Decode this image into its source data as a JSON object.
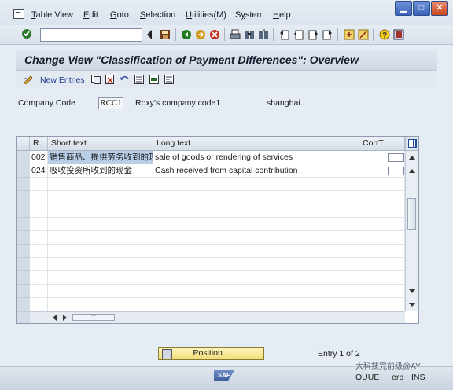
{
  "menu": {
    "items": [
      {
        "label": "Table View",
        "u": "T"
      },
      {
        "label": "Edit",
        "u": "E"
      },
      {
        "label": "Goto",
        "u": "G"
      },
      {
        "label": "Selection",
        "u": "S"
      },
      {
        "label": "Utilities(M)",
        "u": "U"
      },
      {
        "label": "System",
        "u": "y"
      },
      {
        "label": "Help",
        "u": "H"
      }
    ]
  },
  "toolbar": {
    "command_field_value": "",
    "icons": [
      "enter-icon",
      "back-icon",
      "exit-icon",
      "cancel-icon",
      "print-icon",
      "find-icon",
      "find-next-icon",
      "first-page-icon",
      "previous-page-icon",
      "next-page-icon",
      "last-page-icon",
      "create-session-icon",
      "shortcut-icon",
      "help-icon",
      "customize-icon"
    ]
  },
  "screen": {
    "title": "Change View \"Classification of Payment Differences\": Overview"
  },
  "app_toolbar": {
    "new_entries_label": "New Entries"
  },
  "company": {
    "label": "Company Code",
    "code": "RCC1",
    "name": "Roxy's company code1",
    "city": "shanghai"
  },
  "table": {
    "columns": [
      "R..",
      "Short text",
      "Long text",
      "CorrT"
    ],
    "rows": [
      {
        "reason": "002",
        "short_text": "销售商品、提供劳务收到的现...",
        "long_text": "sale of goods or rendering of services"
      },
      {
        "reason": "024",
        "short_text": "吸收投资所收到的现金",
        "long_text": "Cash received from capital contribution"
      }
    ]
  },
  "footer": {
    "position_button": "Position...",
    "entry_info": "Entry 1 of 2"
  },
  "status_bar": {
    "sap_logo": "SAP",
    "mode": "OUUE",
    "server": "erp",
    "insert_mode": "INS",
    "watermark": "大科技完前级@AY"
  },
  "colors": {
    "accent_blue": "#1a3c8a",
    "selection_blue": "#b9cfe8",
    "button_yellow": "#f1dc78"
  }
}
